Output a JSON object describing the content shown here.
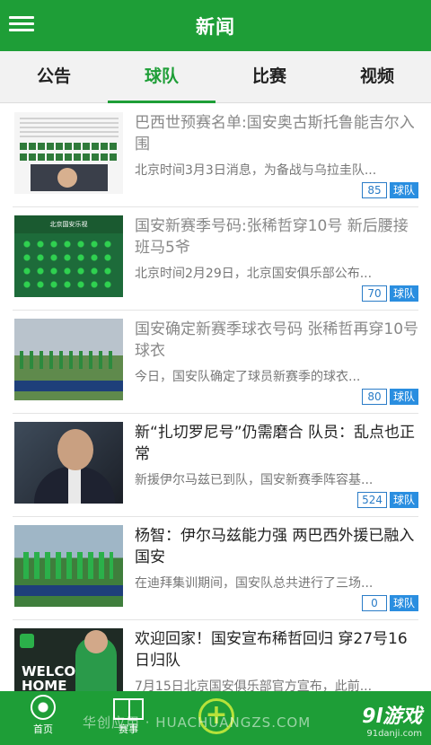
{
  "header": {
    "title": "新闻"
  },
  "tabs": [
    {
      "label": "公告",
      "active": false
    },
    {
      "label": "球队",
      "active": true
    },
    {
      "label": "比赛",
      "active": false
    },
    {
      "label": "视频",
      "active": false
    }
  ],
  "news": [
    {
      "headline": "巴西世预赛名单:国安奥古斯托鲁能吉尔入围",
      "summary": "北京时间3月3日消息，为备战与乌拉圭队...",
      "count": "85",
      "tag": "球队",
      "read": true,
      "thumb": "document-page-photo"
    },
    {
      "headline": "国安新赛季号码:张稀哲穿10号 新后腰接班马5爷",
      "summary": "北京时间2月29日，北京国安俱乐部公布...",
      "count": "70",
      "tag": "球队",
      "read": true,
      "thumb": "team-number-chart",
      "thumb_text": "北京国安乐视"
    },
    {
      "headline": "国安确定新赛季球衣号码 张稀哲再穿10号球衣",
      "summary": "今日，国安队确定了球员新赛季的球衣...",
      "count": "80",
      "tag": "球队",
      "read": true,
      "thumb": "training-pitch-photo"
    },
    {
      "headline": "新“扎切罗尼号”仍需磨合 队员：乱点也正常",
      "summary": "新援伊尔马兹已到队，国安新赛季阵容基...",
      "count": "524",
      "tag": "球队",
      "read": false,
      "thumb": "coach-portrait"
    },
    {
      "headline": "杨智：伊尔马兹能力强 两巴西外援已融入国安",
      "summary": "在迪拜集训期间，国安队总共进行了三场...",
      "count": "0",
      "tag": "球队",
      "read": false,
      "thumb": "training-match-photo"
    },
    {
      "headline": "欢迎回家！国安宣布稀哲回归 穿27号16日归队",
      "summary": "7月15日北京国安俱乐部官方宣布，此前...",
      "count": "",
      "tag": "",
      "read": false,
      "thumb": "welcome-home-poster",
      "thumb_text": "WELCOME HOME"
    }
  ],
  "bottom_nav": [
    {
      "label": "首页",
      "icon": "football-icon"
    },
    {
      "label": "赛事",
      "icon": "pitch-icon"
    },
    {
      "label": "",
      "icon": "plus-icon"
    }
  ],
  "watermark": "华创应用 · HUACHUANGZS.COM",
  "brand": {
    "name": "9l游戏",
    "url": "91danji.com"
  },
  "colors": {
    "primary": "#1e9e37",
    "tag": "#2a8ee0",
    "count": "#2a7cc7",
    "accent": "#b6e23a"
  }
}
